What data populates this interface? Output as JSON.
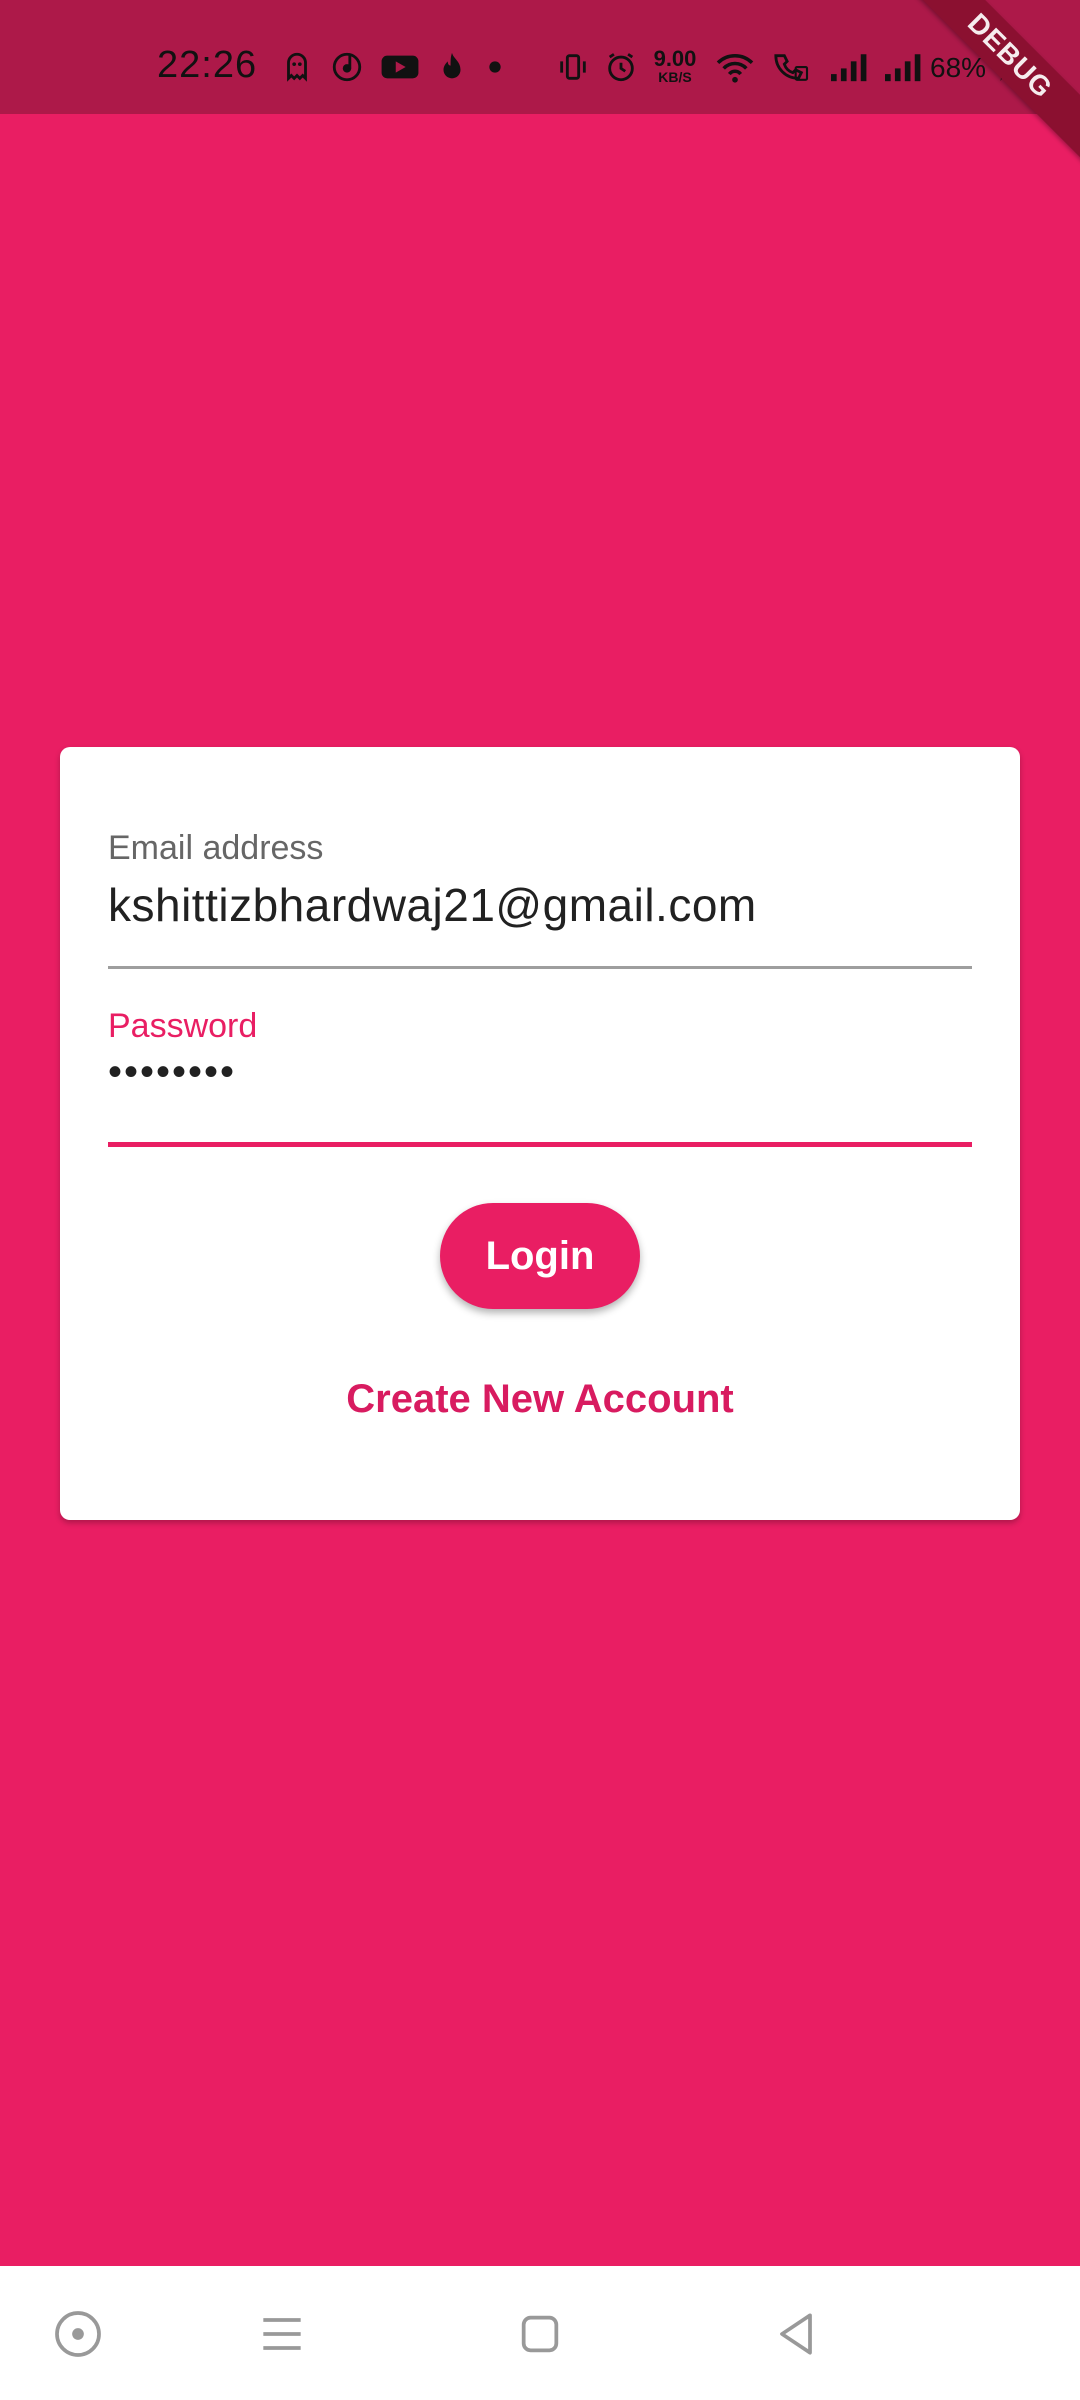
{
  "status_bar": {
    "time": "22:26",
    "net_speed_value": "9.00",
    "net_speed_unit": "KB/S",
    "battery": "68%",
    "icons": [
      "ghost-icon",
      "music-icon",
      "youtube-icon",
      "fire-icon",
      "dot-icon",
      "vibrate-icon",
      "alarm-icon",
      "wifi-icon",
      "wifi-call-icon",
      "signal-icon",
      "signal-icon",
      "charging-icon"
    ]
  },
  "debug_banner": "DEBUG",
  "login_form": {
    "email_label": "Email address",
    "email_value": "kshittizbhardwaj21@gmail.com",
    "password_label": "Password",
    "password_value": "••••••••",
    "login_label": "Login",
    "create_account_label": "Create New Account"
  },
  "nav_bar": {
    "buttons": [
      "assistant-icon",
      "menu-icon",
      "home-icon",
      "back-icon"
    ]
  },
  "colors": {
    "primary": "#E91E63",
    "status_bar": "#AD1949",
    "card": "#FFFFFF"
  }
}
